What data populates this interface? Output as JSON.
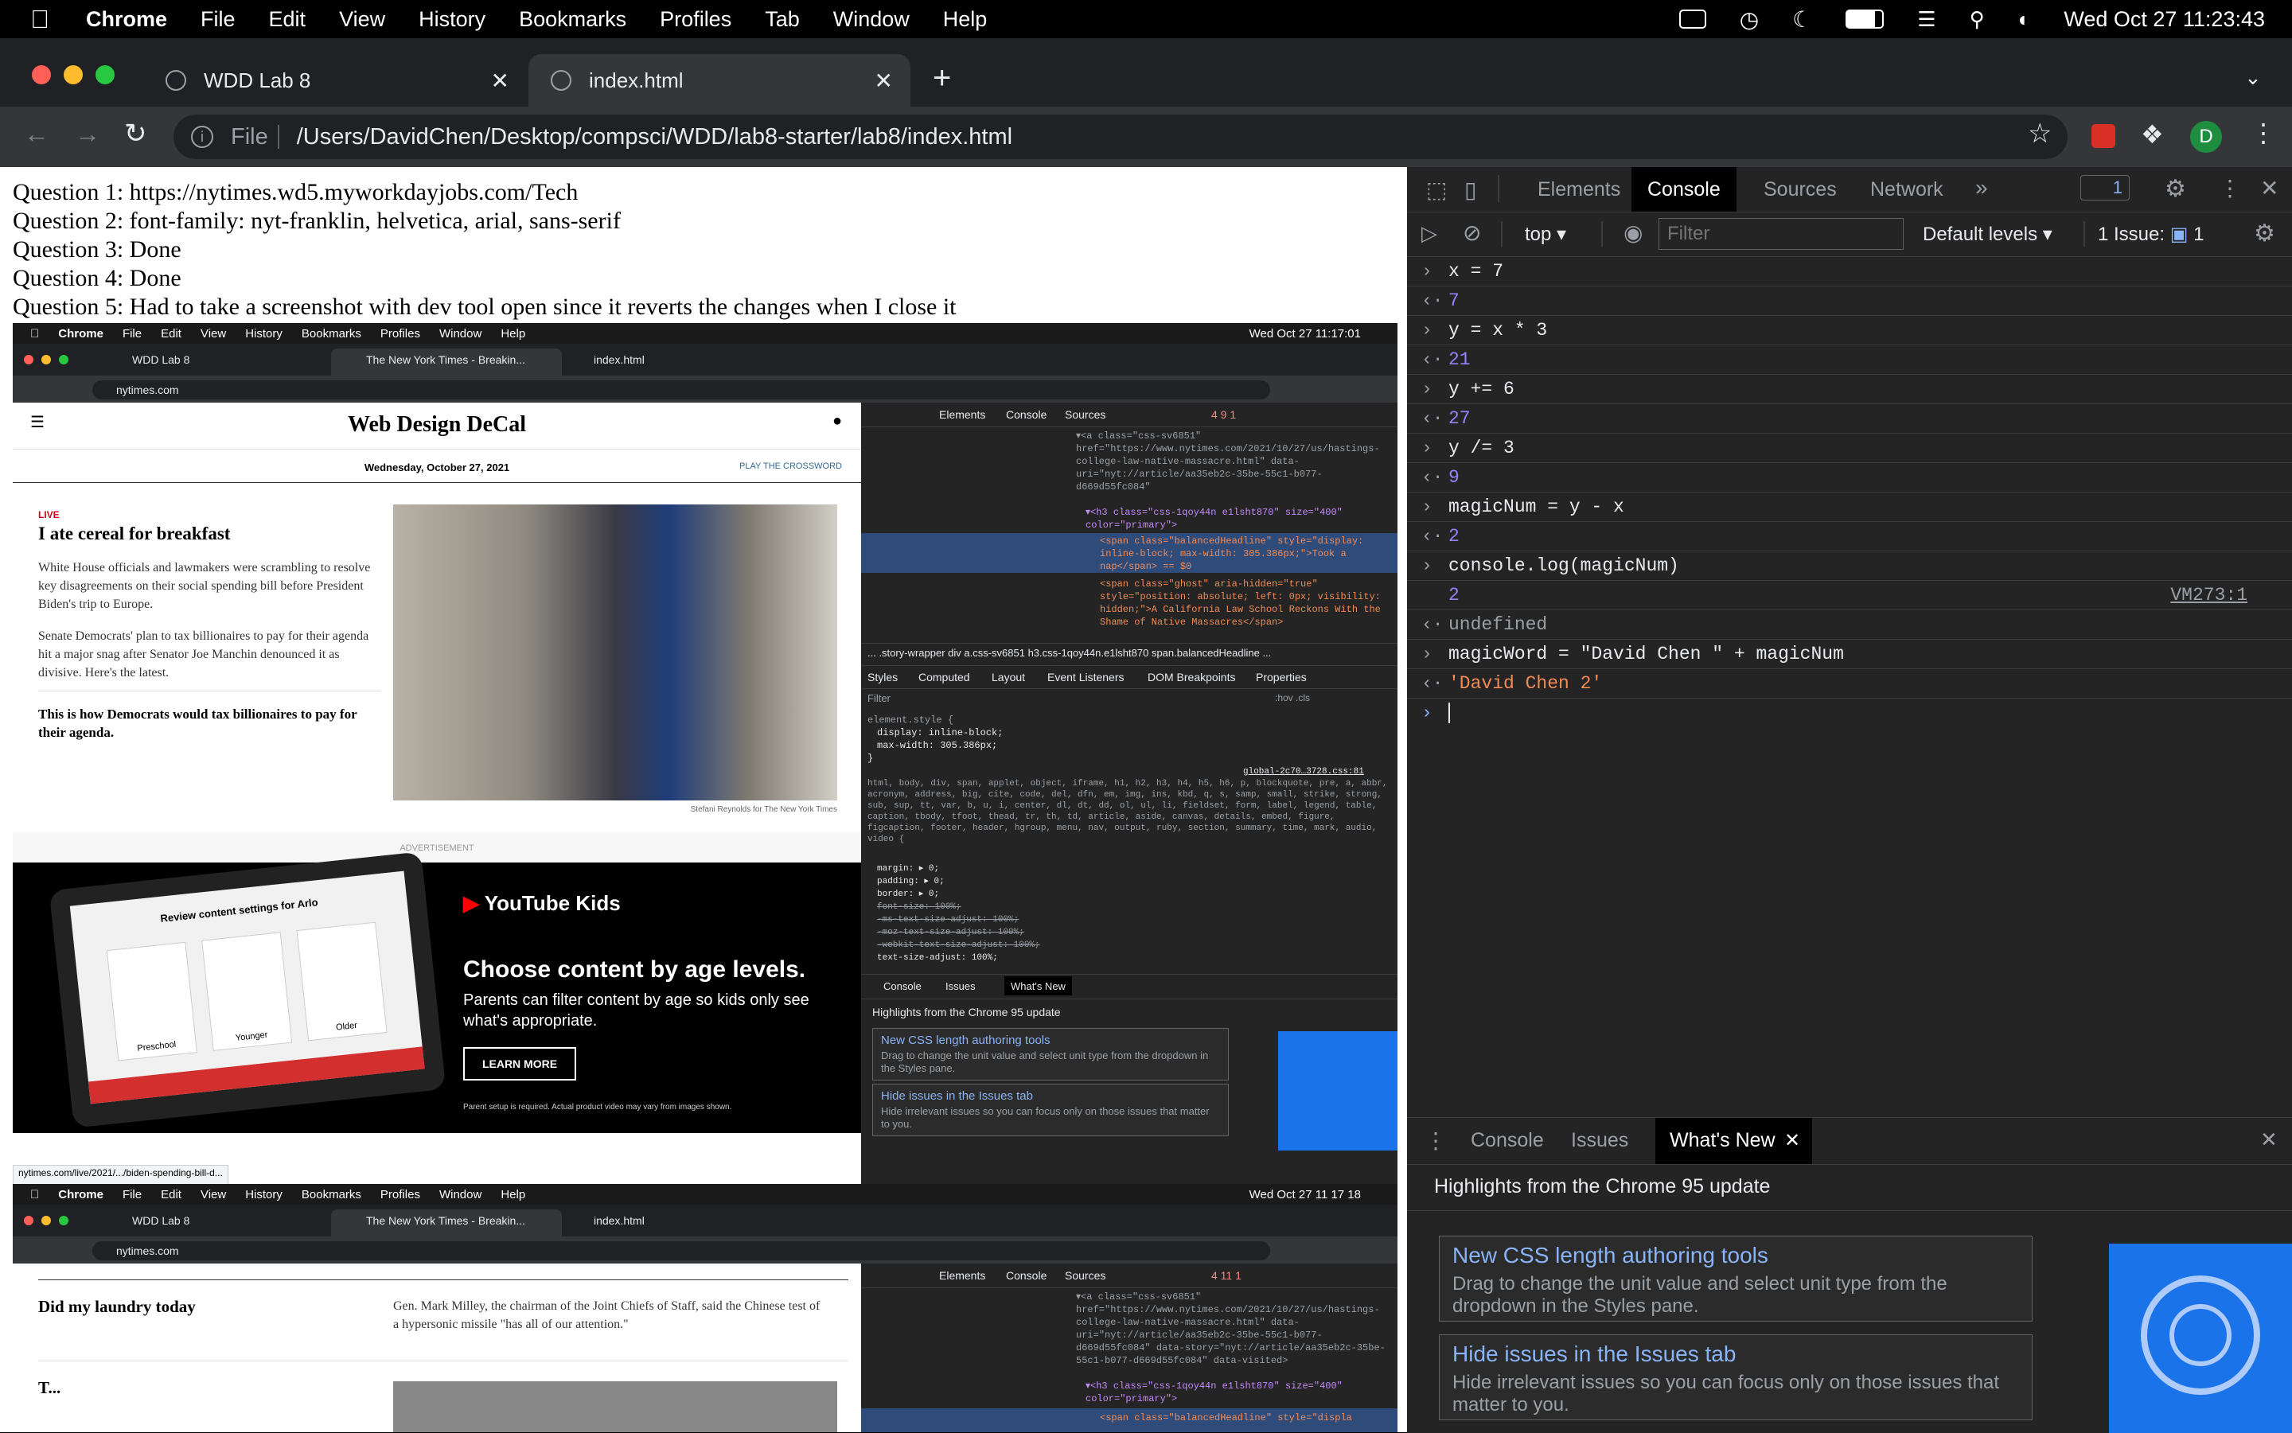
{
  "menubar": {
    "app": "Chrome",
    "items": [
      "File",
      "Edit",
      "View",
      "History",
      "Bookmarks",
      "Profiles",
      "Tab",
      "Window",
      "Help"
    ],
    "clock": "Wed Oct 27  11:23:43"
  },
  "tabs": [
    {
      "title": "WDD Lab 8"
    },
    {
      "title": "index.html"
    }
  ],
  "omnibox": {
    "scheme": "File",
    "url": "/Users/DavidChen/Desktop/compsci/WDD/lab8-starter/lab8/index.html"
  },
  "page": {
    "questions": [
      "Question 1: https://nytimes.wd5.myworkdayjobs.com/Tech",
      "Question 2: font-family: nyt-franklin, helvetica, arial, sans-serif",
      "Question 3: Done",
      "Question 4: Done",
      "Question 5: Had to take a screenshot with dev tool open since it reverts the changes when I close it"
    ]
  },
  "devtools": {
    "tabs": [
      "Elements",
      "Console",
      "Sources",
      "Network"
    ],
    "issues_badge": "1",
    "context": "top",
    "filter_placeholder": "Filter",
    "levels": "Default levels",
    "issues_label": "1 Issue:",
    "issues_count": "1",
    "console": [
      {
        "dir": "in",
        "code": "x = 7"
      },
      {
        "dir": "out",
        "value": "7"
      },
      {
        "dir": "in",
        "code": "y = x * 3"
      },
      {
        "dir": "out",
        "value": "21"
      },
      {
        "dir": "in",
        "code": "y += 6"
      },
      {
        "dir": "out",
        "value": "27"
      },
      {
        "dir": "in",
        "code": "y /= 3"
      },
      {
        "dir": "out",
        "value": "9"
      },
      {
        "dir": "in",
        "code": "magicNum = y - x"
      },
      {
        "dir": "out",
        "value": "2"
      },
      {
        "dir": "in",
        "code": "console.log(magicNum)"
      },
      {
        "dir": "log",
        "value": "2",
        "source": "VM273:1"
      },
      {
        "dir": "out",
        "value": "undefined"
      },
      {
        "dir": "in",
        "code": "magicWord = \"David Chen \" + magicNum"
      },
      {
        "dir": "out",
        "value": "'David Chen 2'"
      }
    ],
    "drawer": {
      "tabs": [
        "Console",
        "Issues",
        "What's New"
      ],
      "heading": "Highlights from the Chrome 95 update",
      "cards": [
        {
          "title": "New CSS length authoring tools",
          "desc": "Drag to change the unit value and select unit type from the dropdown in the Styles pane."
        },
        {
          "title": "Hide issues in the Issues tab",
          "desc": "Hide irrelevant issues so you can focus only on those issues that matter to you."
        }
      ]
    }
  },
  "shot1": {
    "clock": "Wed Oct 27  11:17:01",
    "tabs": [
      "WDD Lab 8",
      "The New York Times - Breakin...",
      "index.html"
    ],
    "url": "nytimes.com",
    "masthead": "Web Design DeCal",
    "date": "Wednesday, October 27, 2021",
    "crossword": "PLAY THE CROSSWORD",
    "live": "LIVE",
    "headline": "I ate cereal for breakfast",
    "bullet1": "White House officials and lawmakers were scrambling to resolve key disagreements on their social spending bill before President Biden's trip to Europe.",
    "bullet2": "Senate Democrats' plan to tax billionaires to pay for their agenda hit a major snag after Senator Joe Manchin denounced it as divisive. Here's the latest.",
    "sub": "This is how Democrats would tax billionaires to pay for their agenda.",
    "credit": "Stefani Reynolds for The New York Times",
    "ad_label": "ADVERTISEMENT",
    "ad_brand": "YouTube Kids",
    "ad_head": "Choose content by age levels.",
    "ad_body": "Parents can filter content by age so kids only see what's appropriate.",
    "ad_cta": "LEARN MORE",
    "ad_fine": "Parent setup is required. Actual product video may vary from images shown.",
    "ad_screen": "Review content settings for Arlo",
    "ad_ages": [
      "Preschool",
      "Younger",
      "Older"
    ],
    "status": "nytimes.com/live/2021/.../biden-spending-bill-d...",
    "dt_tabs": [
      "Elements",
      "Console",
      "Sources"
    ],
    "dt_badges": "4  9  1",
    "code": [
      "▾<a class=\"css-sv6851\" href=\"https://www.nytimes.com/2021/10/27/us/hastings-college-law-native-massacre.html\" data-uri=\"nyt://article/aa35eb2c-35be-55c1-b077-d669d55fc084\"",
      "▾<h3 class=\"css-1qoy44n e1lsht870\" size=\"400\" color=\"primary\">",
      "<span class=\"balancedHeadline\" style=\"display: inline-block; max-width: 305.386px;\">Took a nap</span> == $0",
      "<span class=\"ghost\" aria-hidden=\"true\" style=\"position: absolute; left: 0px; visibility: hidden;\">A California Law School Reckons With the Shame of Native Massacres</span>"
    ],
    "crumbs": "... .story-wrapper  div  a.css-sv6851  h3.css-1qoy44n.e1lsht870  span.balancedHeadline ...",
    "styles_tabs": [
      "Styles",
      "Computed",
      "Layout",
      "Event Listeners",
      "DOM Breakpoints",
      "Properties"
    ],
    "styles_filter": "Filter",
    "styles_hov": ":hov .cls",
    "element_style": "element.style {",
    "es_lines": [
      "display: inline-block;",
      "max-width: 305.386px;"
    ],
    "global_src": "global-2c70…3728.css:81",
    "reset_selector": "html, body, div, span, applet, object, iframe, h1, h2, h3, h4, h5, h6, p, blockquote, pre, a, abbr, acronym, address, big, cite, code, del, dfn, em, img, ins, kbd, q, s, samp, small, strike, strong, sub, sup, tt, var, b, u, i, center, dl, dt, dd, ol, ul, li, fieldset, form, label, legend, table, caption, tbody, tfoot, thead, tr, th, td, article, aside, canvas, details, embed, figure, figcaption, footer, header, hgroup, menu, nav, output, ruby, section, summary, time, mark, audio, video {",
    "reset_props": [
      "margin: ▸ 0;",
      "padding: ▸ 0;",
      "border: ▸ 0;",
      "font-size: 100%;",
      "-ms-text-size-adjust: 100%;",
      "-moz-text-size-adjust: 100%;",
      "-webkit-text-size-adjust: 100%;",
      "text-size-adjust: 100%;"
    ],
    "drawer_tabs": [
      "Console",
      "Issues",
      "What's New"
    ],
    "drawer_head": "Highlights from the Chrome 95 update",
    "card1_t": "New CSS length authoring tools",
    "card1_d": "Drag to change the unit value and select unit type from the dropdown in the Styles pane.",
    "card2_t": "Hide issues in the Issues tab",
    "card2_d": "Hide irrelevant issues so you can focus only on those issues that matter to you."
  },
  "shot2": {
    "clock": "Wed Oct 27  11 17 18",
    "tabs": [
      "WDD Lab 8",
      "The New York Times - Breakin...",
      "index.html"
    ],
    "url": "nytimes.com",
    "headline": "Did my laundry today",
    "blurb": "Gen. Mark Milley, the chairman of the Joint Chiefs of Staff, said the Chinese test of a hypersonic missile \"has all of our attention.\"",
    "cut_text": "T...",
    "dt_tabs": [
      "Elements",
      "Console",
      "Sources"
    ],
    "dt_badges": "4  11  1",
    "code": [
      "▾<a class=\"css-sv6851\" href=\"https://www.nytimes.com/2021/10/27/us/hastings-college-law-native-massacre.html\" data-uri=\"nyt://article/aa35eb2c-35be-55c1-b077-d669d55fc084\" data-story=\"nyt://article/aa35eb2c-35be-55c1-b077-d669d55fc084\" data-visited>",
      "▾<h3 class=\"css-1qoy44n e1lsht870\" size=\"400\" color=\"primary\">",
      "<span class=\"balancedHeadline\" style=\"displa"
    ]
  }
}
